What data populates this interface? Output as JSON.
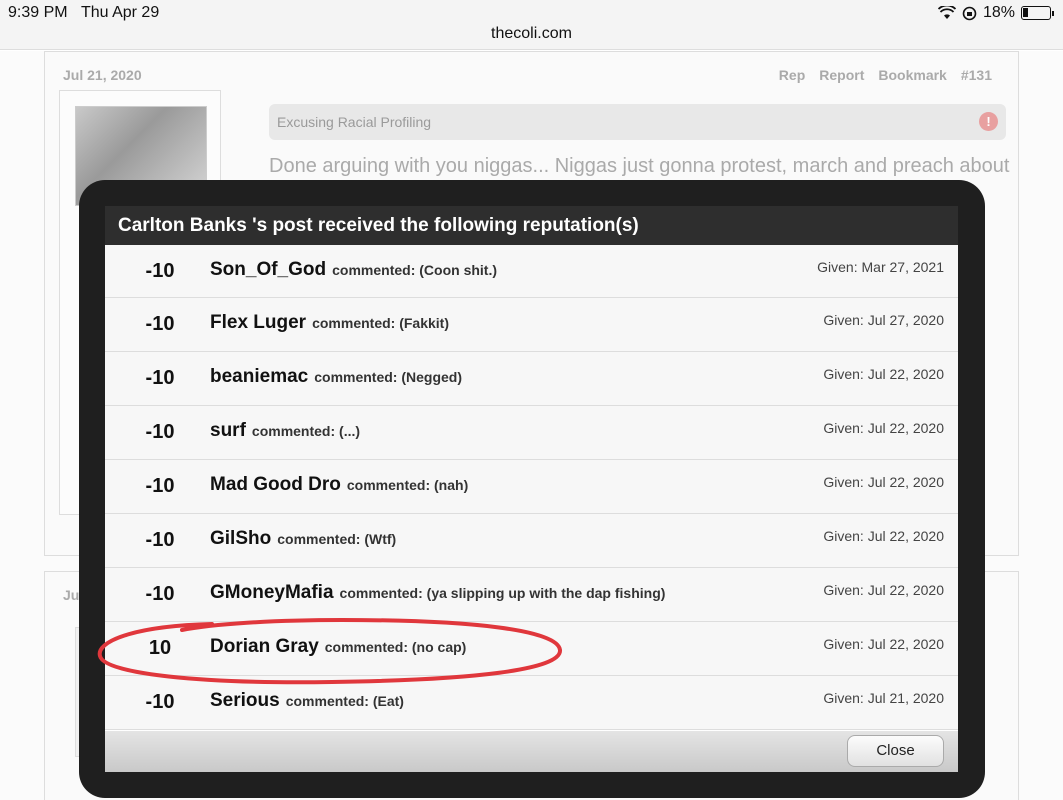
{
  "status_bar": {
    "time": "9:39 PM",
    "date": "Thu Apr 29",
    "url": "thecoli.com",
    "battery": "18%"
  },
  "background_post": {
    "date": "Jul 21, 2020",
    "links": [
      "Rep",
      "Report",
      "Bookmark",
      "#131"
    ],
    "thread_title": "Excusing Racial Profiling",
    "body": "Done arguing with you niggas... Niggas just gonna protest, march and preach about",
    "second_post_date": "Ju"
  },
  "modal": {
    "title": "Carlton Banks 's post received the following reputation(s)",
    "rows": [
      {
        "value": "-10",
        "user": "Son_Of_God",
        "comment": "commented: (Coon shit.)",
        "given": "Given: Mar 27, 2021"
      },
      {
        "value": "-10",
        "user": "Flex Luger",
        "comment": "commented: (Fakkit)",
        "given": "Given: Jul 27, 2020"
      },
      {
        "value": "-10",
        "user": "beaniemac",
        "comment": "commented: (Negged)",
        "given": "Given: Jul 22, 2020"
      },
      {
        "value": "-10",
        "user": "surf",
        "comment": "commented: (...)",
        "given": "Given: Jul 22, 2020"
      },
      {
        "value": "-10",
        "user": "Mad Good Dro",
        "comment": "commented: (nah)",
        "given": "Given: Jul 22, 2020"
      },
      {
        "value": "-10",
        "user": "GilSho",
        "comment": "commented: (Wtf)",
        "given": "Given: Jul 22, 2020"
      },
      {
        "value": "-10",
        "user": "GMoneyMafia",
        "comment": "commented: (ya slipping up with the dap fishing)",
        "given": "Given: Jul 22, 2020"
      },
      {
        "value": "10",
        "user": "Dorian Gray",
        "comment": "commented: (no cap)",
        "given": "Given: Jul 22, 2020"
      },
      {
        "value": "-10",
        "user": "Serious",
        "comment": "commented: (Eat)",
        "given": "Given: Jul 21, 2020"
      }
    ],
    "close_label": "Close"
  },
  "colors": {
    "modal_frame": "#1f1f1f",
    "header_bg": "#2e2e2e",
    "annotation": "#e0373c"
  }
}
